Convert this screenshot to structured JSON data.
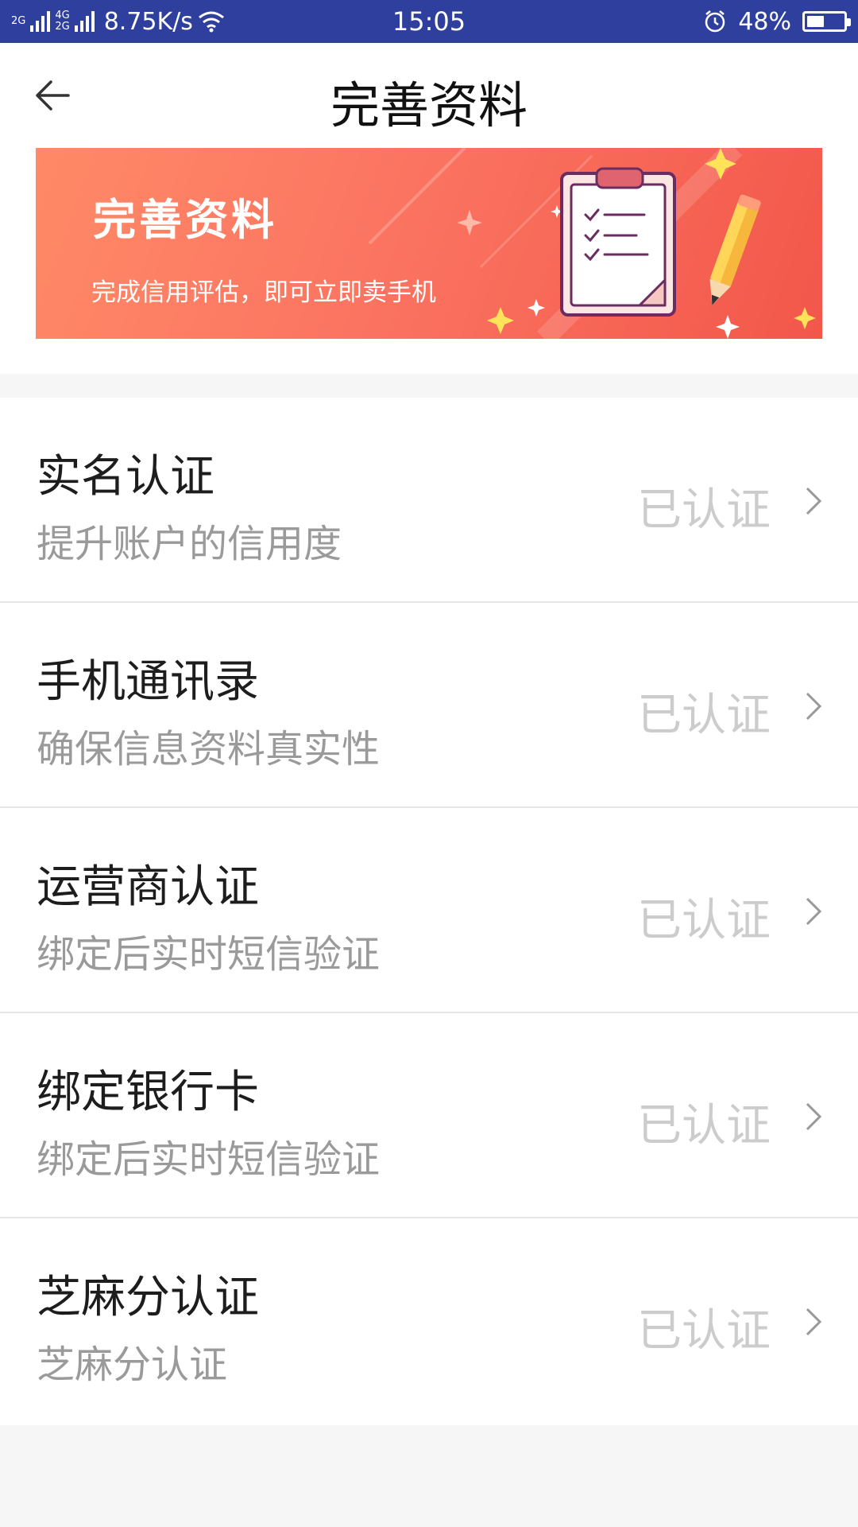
{
  "status_bar": {
    "net_top": "2G",
    "net_mid": "4G",
    "net_bottom": "2G",
    "speed": "8.75K/s",
    "time": "15:05",
    "battery": "48%",
    "battery_level": 0.48,
    "icons": [
      "signal-icon",
      "wifi-icon",
      "alarm-icon",
      "battery-icon"
    ]
  },
  "header": {
    "title": "完善资料",
    "back_icon": "arrow-left-icon"
  },
  "banner": {
    "title": "完善资料",
    "subtitle": "完成信用评估，即可立即卖手机",
    "illustration": "clipboard-checklist-pencil",
    "colors": {
      "start": "#ff8a67",
      "end": "#f2574a"
    }
  },
  "items": [
    {
      "title": "实名认证",
      "subtitle": "提升账户的信用度",
      "status": "已认证"
    },
    {
      "title": "手机通讯录",
      "subtitle": "确保信息资料真实性",
      "status": "已认证"
    },
    {
      "title": "运营商认证",
      "subtitle": "绑定后实时短信验证",
      "status": "已认证"
    },
    {
      "title": "绑定银行卡",
      "subtitle": "绑定后实时短信验证",
      "status": "已认证"
    },
    {
      "title": "芝麻分认证",
      "subtitle": "芝麻分认证",
      "status": "已认证"
    }
  ]
}
